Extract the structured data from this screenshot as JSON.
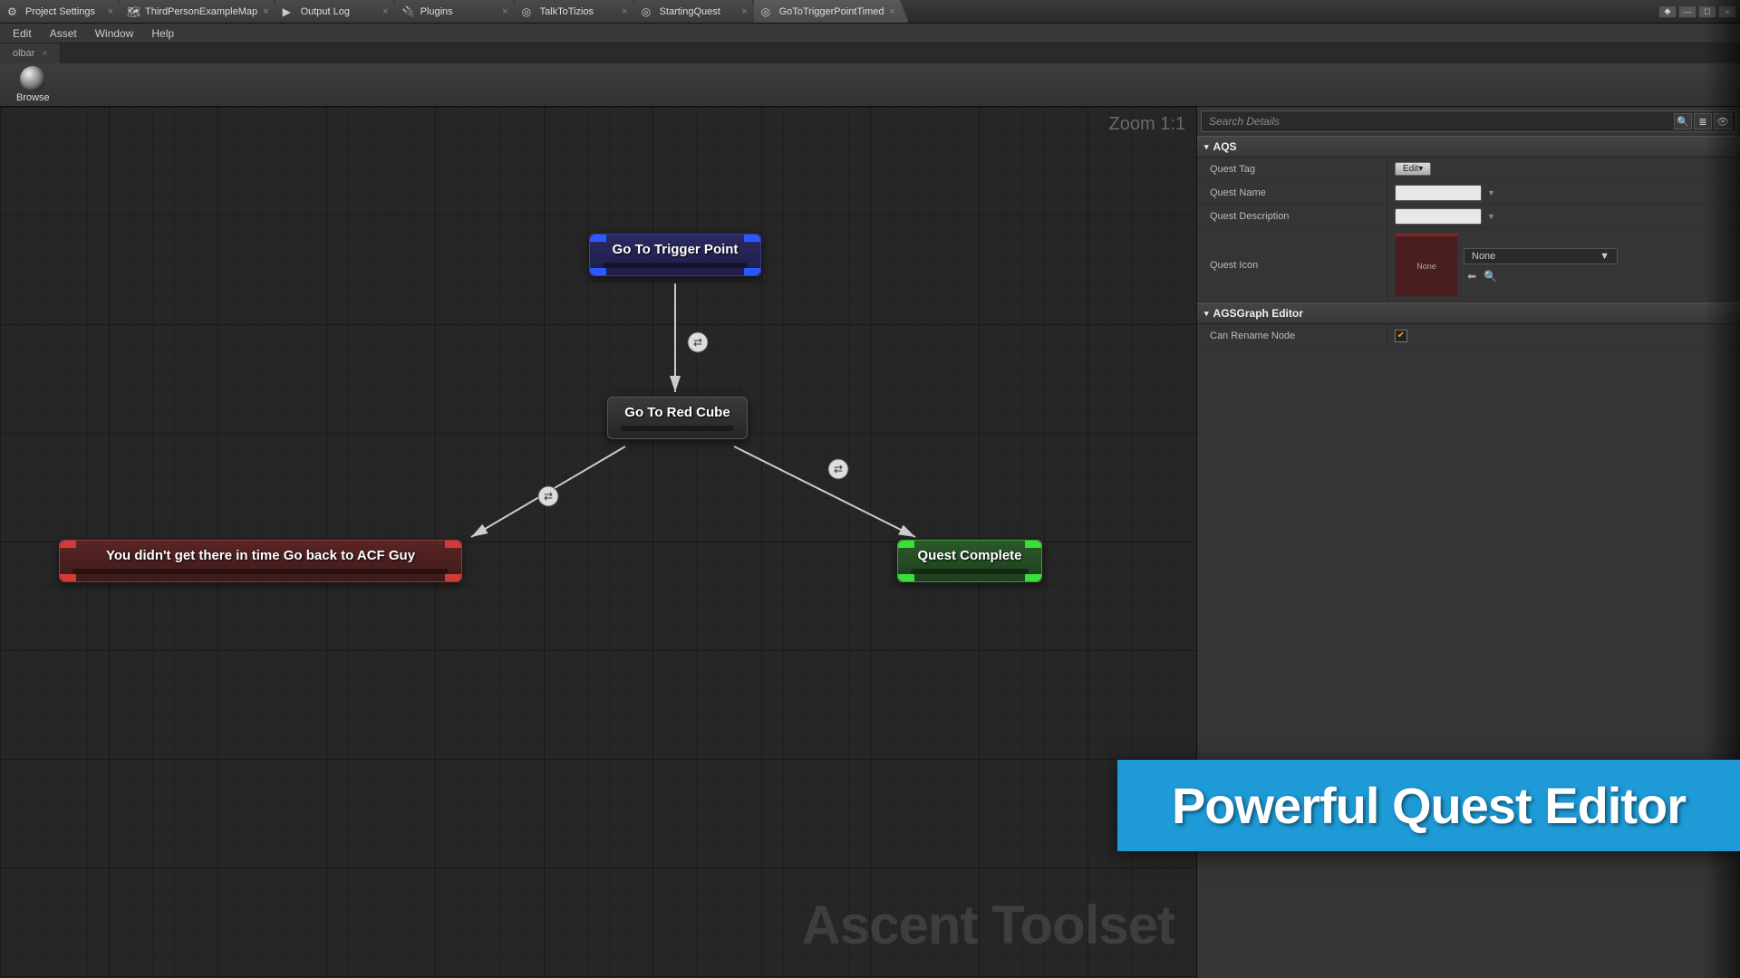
{
  "tabs": [
    {
      "label": "Project Settings",
      "active": false,
      "icon": "gear"
    },
    {
      "label": "ThirdPersonExampleMap",
      "active": false,
      "icon": "map"
    },
    {
      "label": "Output Log",
      "active": false,
      "icon": "log"
    },
    {
      "label": "Plugins",
      "active": false,
      "icon": "plugin"
    },
    {
      "label": "TalkToTizios",
      "active": false,
      "icon": "bp"
    },
    {
      "label": "StartingQuest",
      "active": false,
      "icon": "bp"
    },
    {
      "label": "GoToTriggerPointTimed",
      "active": true,
      "icon": "bp"
    }
  ],
  "menu": [
    "Edit",
    "Asset",
    "Window",
    "Help"
  ],
  "toolbar_tab": "olbar",
  "browse_label": "Browse",
  "zoom_label": "Zoom 1:1",
  "watermark": "Ascent Toolset",
  "nodes": {
    "n1": {
      "label": "Go To Trigger Point"
    },
    "n2": {
      "label": "Go To Red Cube"
    },
    "n3": {
      "label": "You didn't get there in time Go back to ACF Guy"
    },
    "n4": {
      "label": "Quest Complete"
    }
  },
  "details": {
    "search_placeholder": "Search Details",
    "section1": "AQS",
    "quest_tag_label": "Quest Tag",
    "quest_tag_btn": "Edit▾",
    "quest_name_label": "Quest Name",
    "quest_desc_label": "Quest Description",
    "quest_icon_label": "Quest Icon",
    "quest_icon_thumb": "None",
    "quest_icon_dd": "None",
    "section2": "AGSGraph Editor",
    "can_rename_label": "Can Rename Node",
    "can_rename": true
  },
  "banner": "Powerful Quest Editor"
}
